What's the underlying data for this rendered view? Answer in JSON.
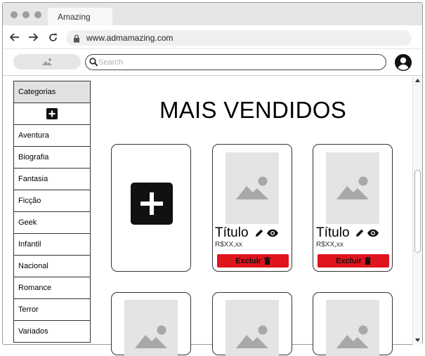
{
  "browser": {
    "tab_title": "Amazing",
    "url": "www.admamazing.com"
  },
  "header": {
    "search_placeholder": "Search"
  },
  "sidebar": {
    "header": "Categorias",
    "items": [
      {
        "label": "Aventura"
      },
      {
        "label": "Biografia"
      },
      {
        "label": "Fantasia"
      },
      {
        "label": "Ficção"
      },
      {
        "label": "Geek"
      },
      {
        "label": "Infantil"
      },
      {
        "label": "Nacional"
      },
      {
        "label": "Romance"
      },
      {
        "label": "Terror"
      },
      {
        "label": "Variados"
      }
    ]
  },
  "main": {
    "title": "MAIS VENDIDOS",
    "products": [
      {
        "title": "Título",
        "price": "R$XX,xx",
        "delete_label": "Excluir"
      },
      {
        "title": "Título",
        "price": "R$XX,xx",
        "delete_label": "Excluir"
      }
    ]
  },
  "colors": {
    "delete_button": "#e0141c",
    "image_placeholder": "#e4e4e4",
    "sidebar_header": "#e2e2e2"
  },
  "icons": [
    "back-arrow-icon",
    "forward-arrow-icon",
    "reload-icon",
    "lock-icon",
    "image-icon",
    "search-icon",
    "user-avatar-icon",
    "plus-icon",
    "pencil-icon",
    "eye-icon",
    "trash-icon"
  ]
}
